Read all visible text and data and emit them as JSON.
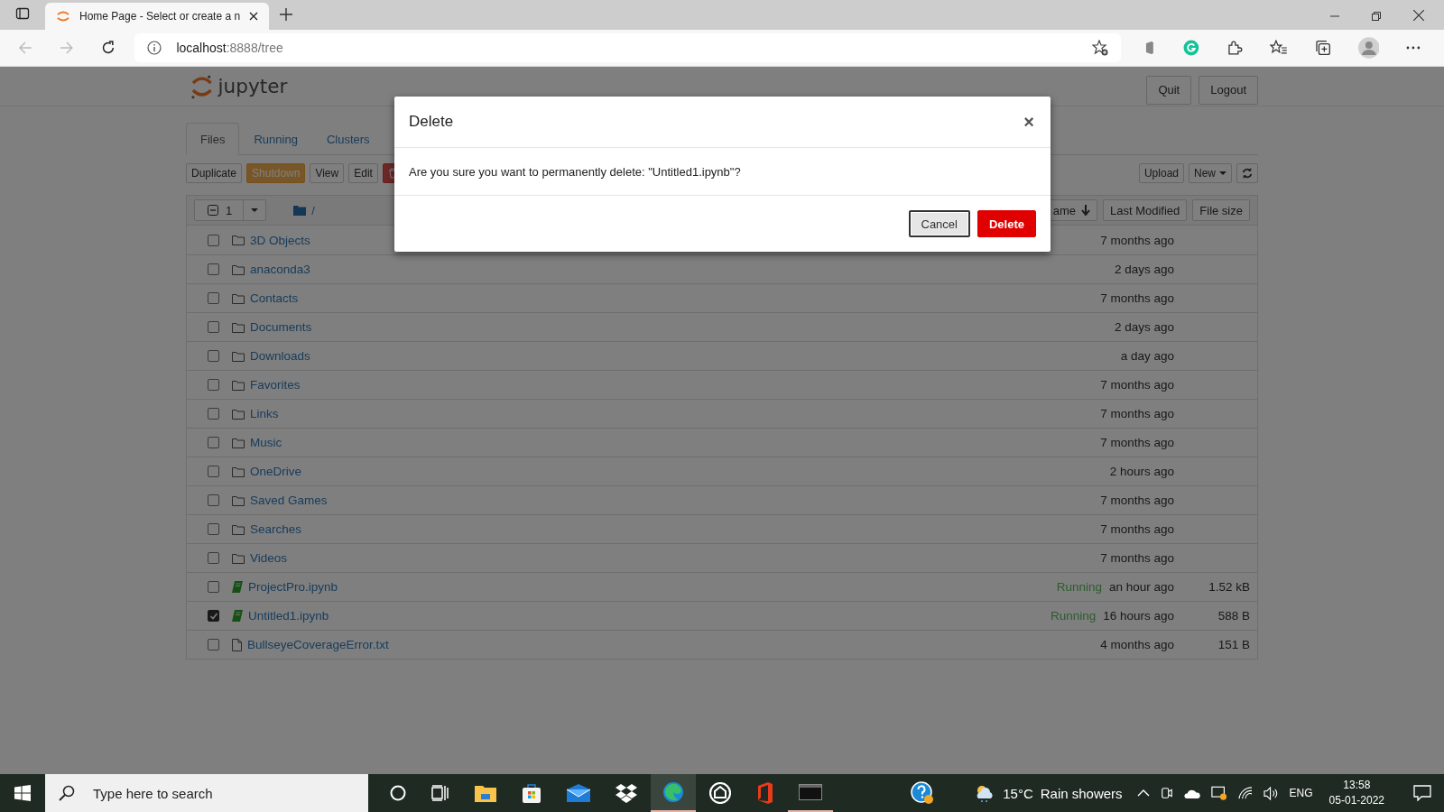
{
  "browser": {
    "tab_title": "Home Page - Select or create a n",
    "url_host": "localhost",
    "url_path": ":8888/tree"
  },
  "header": {
    "logo_text": "jupyter",
    "buttons": [
      "Quit",
      "Logout"
    ]
  },
  "tabs": [
    {
      "label": "Files",
      "selected": true
    },
    {
      "label": "Running",
      "selected": false
    },
    {
      "label": "Clusters",
      "selected": false
    }
  ],
  "toolbar": {
    "buttons": [
      {
        "label": "Duplicate",
        "kind": "default"
      },
      {
        "label": "Shutdown",
        "kind": "warning"
      },
      {
        "label": "View",
        "kind": "default"
      },
      {
        "label": "Edit",
        "kind": "default"
      },
      {
        "kind": "trash"
      }
    ],
    "right_buttons": [
      "Upload",
      "New"
    ]
  },
  "list_header": {
    "selected_count": "1",
    "path": "/",
    "sort_buttons": [
      "ame",
      "Last Modified",
      "File size"
    ]
  },
  "rows": [
    {
      "name": "3D Objects",
      "kind": "folder",
      "checked": false,
      "modified": "7 months ago"
    },
    {
      "name": "anaconda3",
      "kind": "folder",
      "checked": false,
      "modified": "2 days ago"
    },
    {
      "name": "Contacts",
      "kind": "folder",
      "checked": false,
      "modified": "7 months ago"
    },
    {
      "name": "Documents",
      "kind": "folder",
      "checked": false,
      "modified": "2 days ago"
    },
    {
      "name": "Downloads",
      "kind": "folder",
      "checked": false,
      "modified": "a day ago"
    },
    {
      "name": "Favorites",
      "kind": "folder",
      "checked": false,
      "modified": "7 months ago"
    },
    {
      "name": "Links",
      "kind": "folder",
      "checked": false,
      "modified": "7 months ago"
    },
    {
      "name": "Music",
      "kind": "folder",
      "checked": false,
      "modified": "7 months ago"
    },
    {
      "name": "OneDrive",
      "kind": "folder",
      "checked": false,
      "modified": "2 hours ago"
    },
    {
      "name": "Saved Games",
      "kind": "folder",
      "checked": false,
      "modified": "7 months ago"
    },
    {
      "name": "Searches",
      "kind": "folder",
      "checked": false,
      "modified": "7 months ago"
    },
    {
      "name": "Videos",
      "kind": "folder",
      "checked": false,
      "modified": "7 months ago"
    },
    {
      "name": "ProjectPro.ipynb",
      "kind": "notebook",
      "checked": false,
      "status": "Running",
      "modified": "an hour ago",
      "size": "1.52 kB"
    },
    {
      "name": "Untitled1.ipynb",
      "kind": "notebook",
      "checked": true,
      "status": "Running",
      "modified": "16 hours ago",
      "size": "588 B"
    },
    {
      "name": "BullseyeCoverageError.txt",
      "kind": "file",
      "checked": false,
      "modified": "4 months ago",
      "size": "151 B"
    }
  ],
  "dialog": {
    "title": "Delete",
    "close": "×",
    "message": "Are you sure you want to permanently delete: \"Untitled1.ipynb\"?",
    "buttons": [
      {
        "label": "Cancel",
        "kind": "default"
      },
      {
        "label": "Delete",
        "kind": "danger"
      }
    ]
  },
  "taskbar": {
    "search_placeholder": "Type here to search",
    "temperature": "15°C",
    "weather": "Rain showers",
    "language": "ENG",
    "time": "13:58",
    "date": "05-01-2022"
  }
}
